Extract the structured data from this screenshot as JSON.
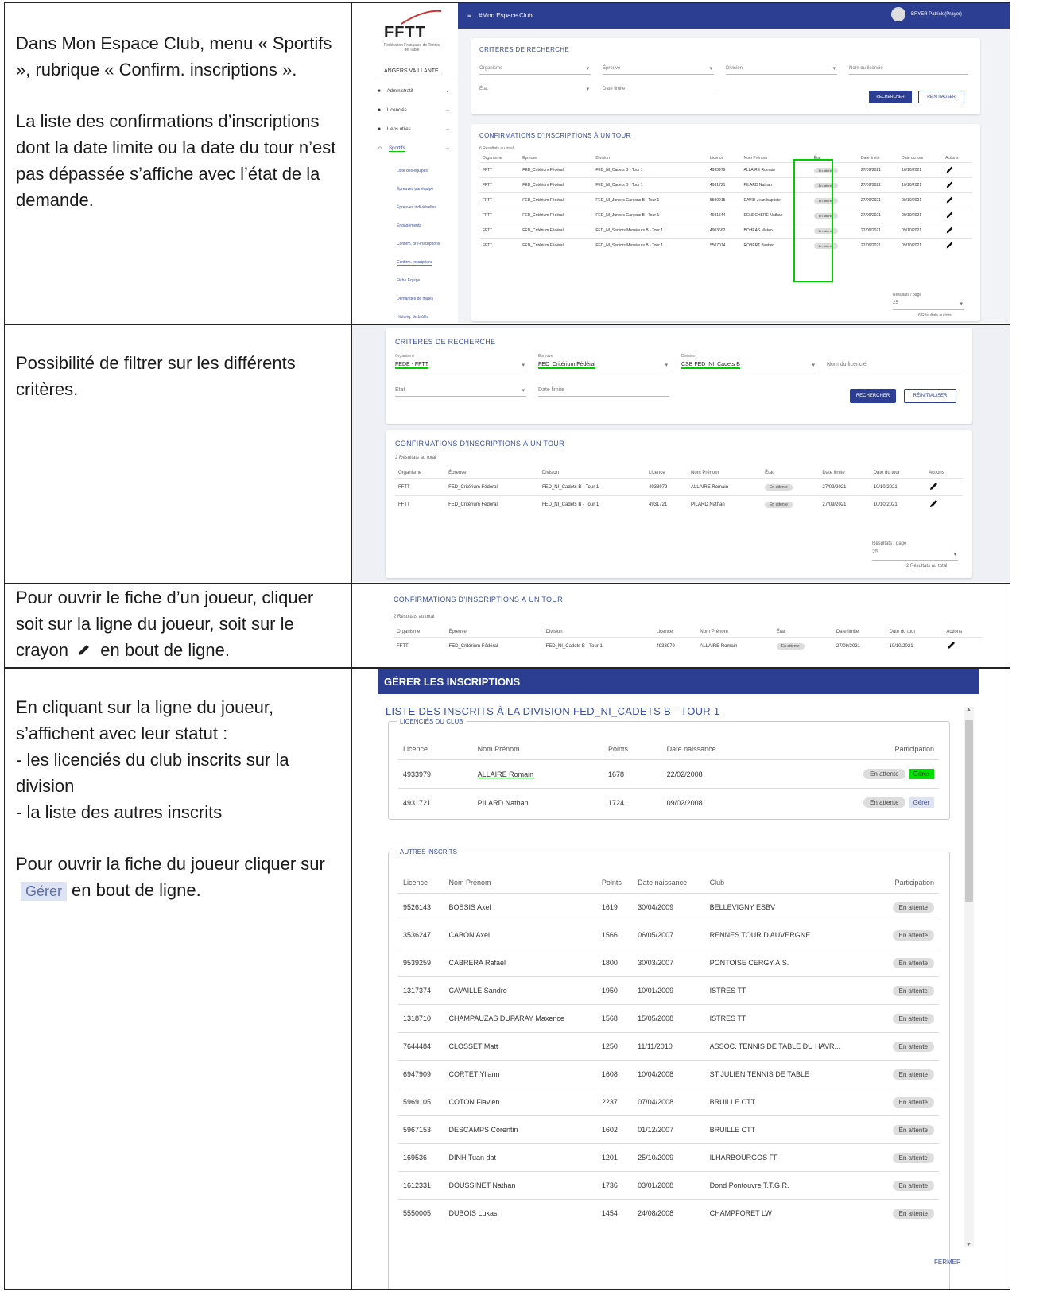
{
  "rows": [
    {
      "paragraphs": [
        "Dans Mon Espace Club, menu « Sportifs », rubrique « Confirm. inscriptions ».",
        "La liste des confirmations d’inscriptions dont la date limite ou la date du tour n’est pas dépassée s’affiche avec l’état de la demande."
      ]
    },
    {
      "paragraphs": [
        "Possibilité de filtrer sur les différents critères."
      ]
    },
    {
      "paragraphs": [
        "Pour ouvrir le fiche d’un joueur, cliquer soit sur la ligne du joueur, soit sur le crayon",
        "en bout de ligne."
      ]
    },
    {
      "paragraphs": [
        "En cliquant sur la ligne du joueur, s’affichent avec leur statut :",
        "- les licenciés du club inscrits sur la division",
        "- la liste des autres inscrits",
        "Pour ouvrir la fiche du joueur cliquer sur",
        "Gérer",
        "en bout de ligne."
      ]
    }
  ],
  "app": {
    "logo": "FFTT",
    "logo_sub": "Fédération Française de Tennis de Table",
    "topbar_title": "#Mon Espace Club",
    "user_name": "BRYER Patrick (Prayer)",
    "club_name": "ANGERS VAILLANTE ...",
    "menu": [
      "Administratif",
      "Licenciés",
      "Liens utiles",
      "Sportifs"
    ],
    "submenu": [
      "Liste des équipes",
      "Épreuves par équipe",
      "Épreuves individuelles",
      "Engagements",
      "Confirm. pré-inscriptions",
      "Confirm. inscriptions",
      "Fiche Équipe",
      "Demandes de mutés",
      "Historiq. de brûlés"
    ]
  },
  "criteria": {
    "title": "CRITERES DE RECHERCHE",
    "organisme_label": "Organisme",
    "epreuve_label": "Épreuve",
    "division_label": "Division",
    "nom_label": "Nom du licencié",
    "etat_label": "État",
    "date_label": "Date limite",
    "search_btn": "RECHERCHER",
    "reset_btn": "RÉINITIALISER",
    "org_value": "FEDE - FFTT",
    "epreuve_value": "FED_Critérium Fédéral",
    "division_value": "CSB FED_NI_Cadets B"
  },
  "list": {
    "title": "CONFIRMATIONS D’INSCRIPTIONS À UN TOUR",
    "count1": "6 Résultats au total",
    "count2": "2 Résultats au total",
    "headers": [
      "Organisme",
      "Épreuve",
      "Division",
      "Licence",
      "Nom Prénom",
      "État",
      "Date limite",
      "Date du tour",
      "Actions"
    ],
    "rows": [
      [
        "FFTT",
        "FED_Critérium Fédéral",
        "FED_NI_Cadets B - Tour 1",
        "4933979",
        "ALLAIRE Romain",
        "En attente",
        "27/09/2021",
        "10/10/2021"
      ],
      [
        "FFTT",
        "FED_Critérium Fédéral",
        "FED_NI_Cadets B - Tour 1",
        "4931721",
        "PILARD Nathan",
        "En attente",
        "27/09/2021",
        "10/10/2021"
      ],
      [
        "FFTT",
        "FED_Critérium Fédéral",
        "FED_NI_Juniors Garçons B - Tour 1",
        "5500915",
        "DAVID Jean-baptiste",
        "En attente",
        "27/09/2021",
        "09/10/2021"
      ],
      [
        "FFTT",
        "FED_Critérium Fédéral",
        "FED_NI_Juniors Garçons B - Tour 1",
        "4931644",
        "DENECHERE Nathan",
        "En attente",
        "27/09/2021",
        "09/10/2021"
      ],
      [
        "FFTT",
        "FED_Critérium Fédéral",
        "FED_NI_Seniors Messieurs B - Tour 1",
        "4903662",
        "BOHEAS Mateo",
        "En attente",
        "27/09/2021",
        "09/10/2021"
      ],
      [
        "FFTT",
        "FED_Critérium Fédéral",
        "FED_NI_Seniors Messieurs B - Tour 1",
        "5507014",
        "ROBERT Bastien",
        "En attente",
        "27/09/2021",
        "09/10/2021"
      ]
    ],
    "per_page_label": "Résultats / page",
    "per_page_value": "25"
  },
  "modal": {
    "header": "GÉRER LES INSCRIPTIONS",
    "title": "LISTE DES INSCRITS À LA DIVISION FED_NI_CADETS B - TOUR 1",
    "club_legend": "LICENCIÉS DU CLUB",
    "others_legend": "AUTRES INSCRITS",
    "club_headers": [
      "Licence",
      "Nom Prénom",
      "Points",
      "Date naissance",
      "Participation"
    ],
    "club_rows": [
      [
        "4933979",
        "ALLAIRE Romain",
        "1678",
        "22/02/2008",
        "En attente",
        "Gérer"
      ],
      [
        "4931721",
        "PILARD Nathan",
        "1724",
        "09/02/2008",
        "En attente",
        "Gérer"
      ]
    ],
    "others_headers": [
      "Licence",
      "Nom Prénom",
      "Points",
      "Date naissance",
      "Club",
      "Participation"
    ],
    "others_rows": [
      [
        "9526143",
        "BOSSIS Axel",
        "1619",
        "30/04/2009",
        "BELLEVIGNY ESBV",
        "En attente"
      ],
      [
        "3536247",
        "CABON Axel",
        "1566",
        "06/05/2007",
        "RENNES TOUR D AUVERGNE",
        "En attente"
      ],
      [
        "9539259",
        "CABRERA Rafael",
        "1800",
        "30/03/2007",
        "PONTOISE CERGY A.S.",
        "En attente"
      ],
      [
        "1317374",
        "CAVAILLE Sandro",
        "1950",
        "10/01/2009",
        "ISTRES TT",
        "En attente"
      ],
      [
        "1318710",
        "CHAMPAUZAS DUPARAY Maxence",
        "1568",
        "15/05/2008",
        "ISTRES TT",
        "En attente"
      ],
      [
        "7644484",
        "CLOSSET Matt",
        "1250",
        "11/11/2010",
        "ASSOC. TENNIS DE TABLE DU HAVR...",
        "En attente"
      ],
      [
        "6947909",
        "CORTET Yliann",
        "1608",
        "10/04/2008",
        "ST JULIEN TENNIS DE TABLE",
        "En attente"
      ],
      [
        "5969105",
        "COTON Flavien",
        "2237",
        "07/04/2008",
        "BRUILLE CTT",
        "En attente"
      ],
      [
        "5967153",
        "DESCAMPS Corentin",
        "1602",
        "01/12/2007",
        "BRUILLE CTT",
        "En attente"
      ],
      [
        "169536",
        "DINH Tuan dat",
        "1201",
        "25/10/2009",
        "ILHARBOURGOS FF",
        "En attente"
      ],
      [
        "1612331",
        "DOUSSINET Nathan",
        "1736",
        "03/01/2008",
        "Dond Pontouvre T.T.G.R.",
        "En attente"
      ],
      [
        "5550005",
        "DUBOIS Lukas",
        "1454",
        "24/08/2008",
        "CHAMPFORET LW",
        "En attente"
      ]
    ],
    "close_btn": "FERMER"
  },
  "colors": {
    "highlight": "#00e000",
    "primary": "#2c3e92",
    "title_blue": "#3b4fa0"
  }
}
